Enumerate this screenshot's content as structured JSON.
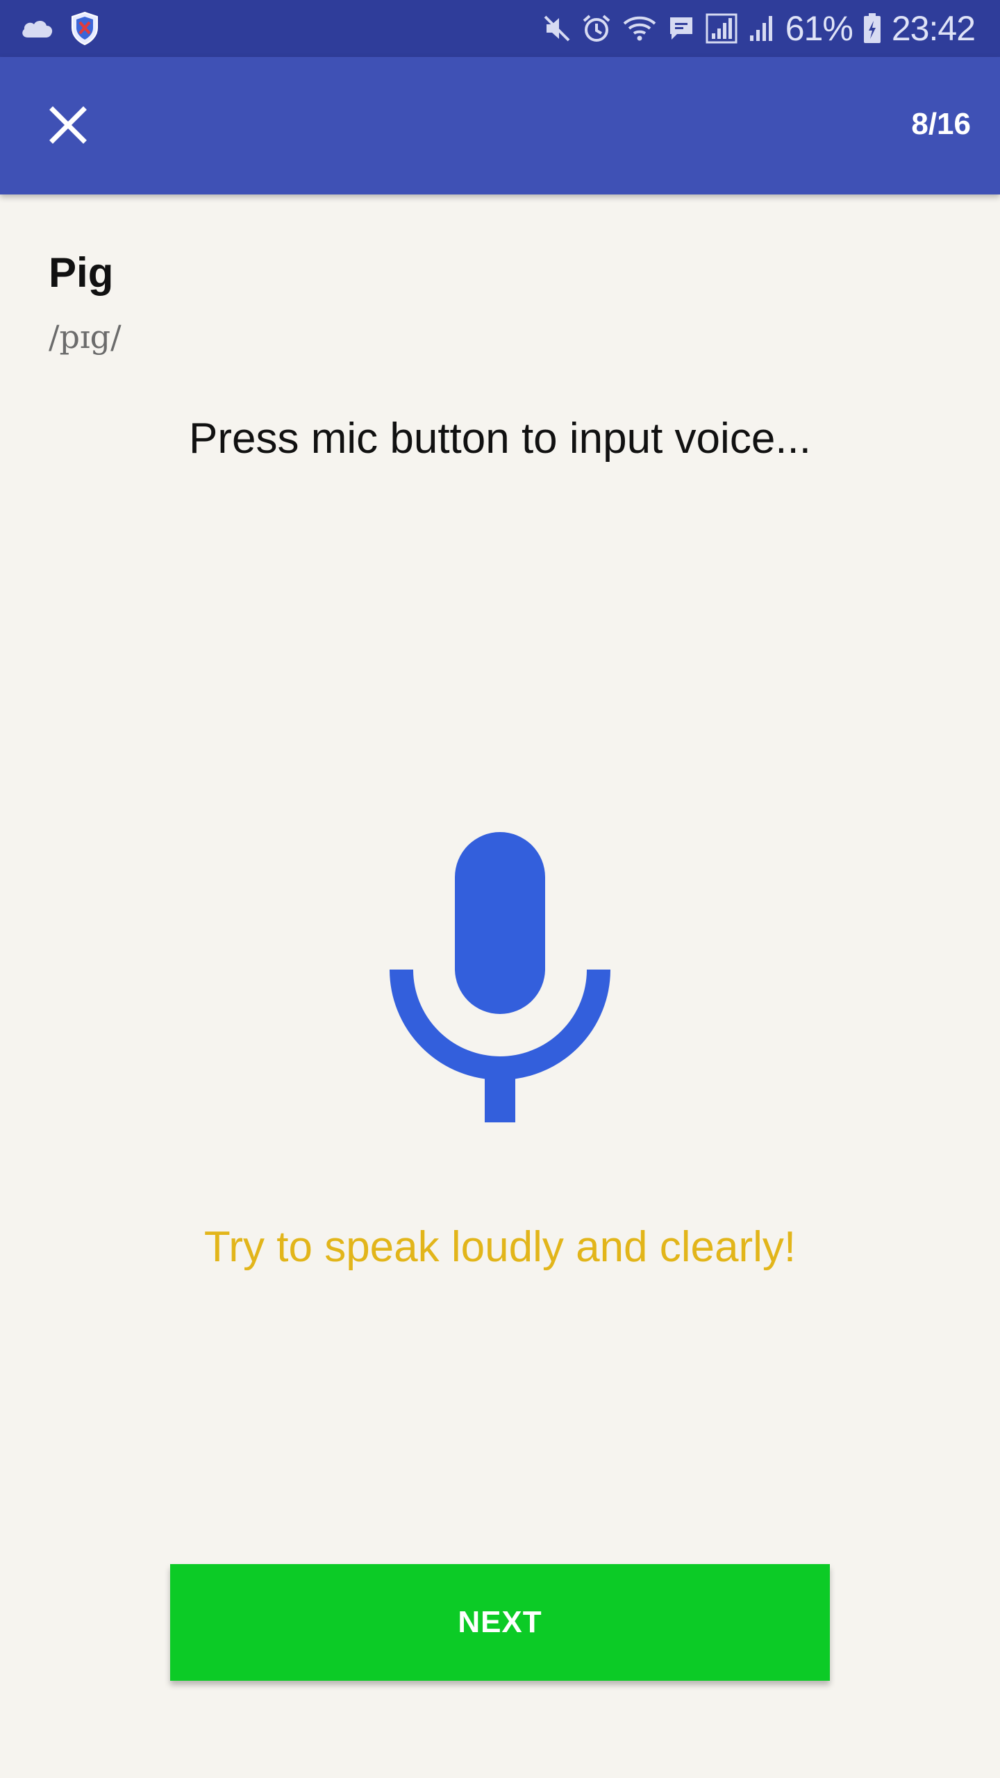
{
  "status_bar": {
    "icons_left": [
      "cloud-icon",
      "shield-icon"
    ],
    "icons_right": [
      "mute-icon",
      "alarm-icon",
      "wifi-icon",
      "message-icon",
      "signal-icon",
      "signal-icon"
    ],
    "battery_percent": "61%",
    "time": "23:42"
  },
  "app_bar": {
    "close_icon": "close-icon",
    "progress": "8/16",
    "background": "#3f51b5"
  },
  "lesson": {
    "word": "Pig",
    "phonetic": "/pɪg/",
    "instruction": "Press mic button to input voice...",
    "mic_icon": "microphone-icon",
    "mic_color": "#335fdc",
    "hint": "Try to speak loudly and clearly!",
    "hint_color": "#e2b51a"
  },
  "actions": {
    "next_label": "NEXT",
    "next_color": "#0ccb26"
  }
}
